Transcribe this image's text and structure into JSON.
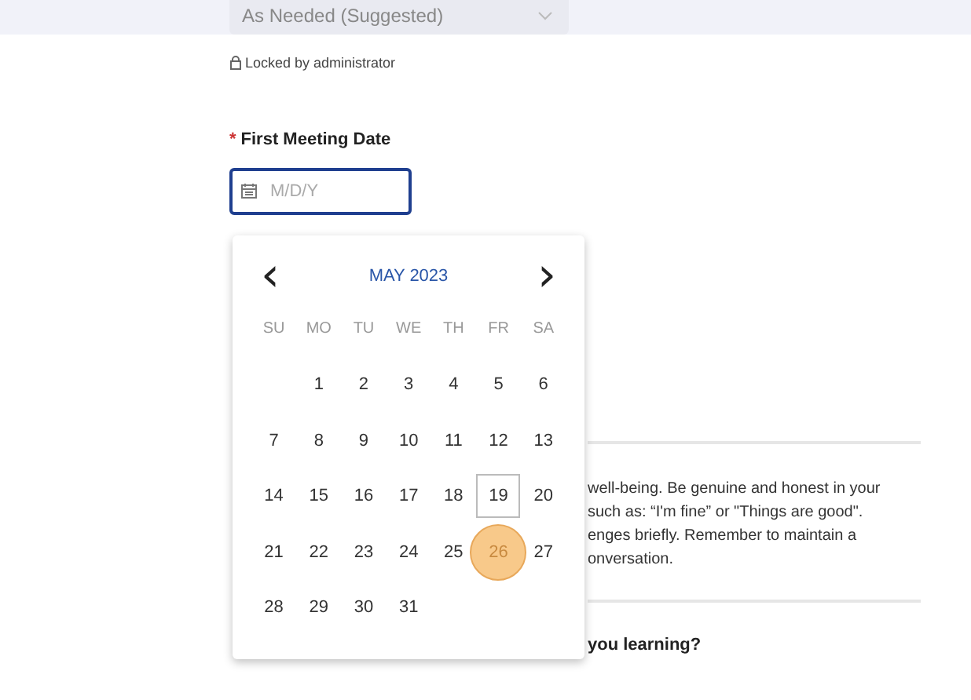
{
  "frequency_select": {
    "value": "As Needed (Suggested)"
  },
  "lock_note": "Locked by administrator",
  "date_field": {
    "label": "First Meeting Date",
    "required_mark": "*",
    "placeholder": "M/D/Y"
  },
  "calendar": {
    "month": "MAY 2023",
    "prev": "‹",
    "next": "›",
    "weekdays": [
      "SU",
      "MO",
      "TU",
      "WE",
      "TH",
      "FR",
      "SA"
    ],
    "first_week_starts_monday": true,
    "weeks": [
      [
        {
          "day": "1",
          "today": false,
          "selected": false
        },
        {
          "day": "2",
          "today": false,
          "selected": false
        },
        {
          "day": "3",
          "today": false,
          "selected": false
        },
        {
          "day": "4",
          "today": false,
          "selected": false
        },
        {
          "day": "5",
          "today": false,
          "selected": false
        },
        {
          "day": "6",
          "today": false,
          "selected": false
        }
      ],
      [
        {
          "day": "7",
          "today": false,
          "selected": false
        },
        {
          "day": "8",
          "today": false,
          "selected": false
        },
        {
          "day": "9",
          "today": false,
          "selected": false
        },
        {
          "day": "10",
          "today": false,
          "selected": false
        },
        {
          "day": "11",
          "today": false,
          "selected": false
        },
        {
          "day": "12",
          "today": false,
          "selected": false
        },
        {
          "day": "13",
          "today": false,
          "selected": false
        }
      ],
      [
        {
          "day": "14",
          "today": false,
          "selected": false
        },
        {
          "day": "15",
          "today": false,
          "selected": false
        },
        {
          "day": "16",
          "today": false,
          "selected": false
        },
        {
          "day": "17",
          "today": false,
          "selected": false
        },
        {
          "day": "18",
          "today": false,
          "selected": false
        },
        {
          "day": "19",
          "today": true,
          "selected": false
        },
        {
          "day": "20",
          "today": false,
          "selected": false
        }
      ],
      [
        {
          "day": "21",
          "today": false,
          "selected": false
        },
        {
          "day": "22",
          "today": false,
          "selected": false
        },
        {
          "day": "23",
          "today": false,
          "selected": false
        },
        {
          "day": "24",
          "today": false,
          "selected": false
        },
        {
          "day": "25",
          "today": false,
          "selected": false
        },
        {
          "day": "26",
          "today": false,
          "selected": true
        },
        {
          "day": "27",
          "today": false,
          "selected": false
        }
      ],
      [
        {
          "day": "28",
          "today": false,
          "selected": false
        },
        {
          "day": "29",
          "today": false,
          "selected": false
        },
        {
          "day": "30",
          "today": false,
          "selected": false
        },
        {
          "day": "31",
          "today": false,
          "selected": false
        }
      ]
    ]
  },
  "guidance": "well-being. Be genuine and honest in your\nsuch as: “I'm fine” or \"Things are good\".\nenges briefly. Remember to maintain a\nonversation.",
  "next_question": "you learning?"
}
